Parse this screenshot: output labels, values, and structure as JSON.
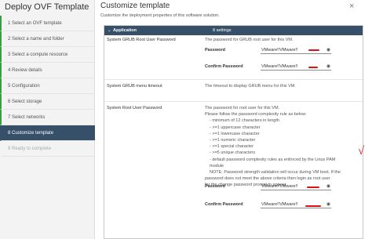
{
  "wizard": {
    "title": "Deploy OVF Template",
    "steps": [
      {
        "label": "1  Select an OVF template",
        "state": "done"
      },
      {
        "label": "2  Select a name and folder",
        "state": "done"
      },
      {
        "label": "3  Select a compute resource",
        "state": "done"
      },
      {
        "label": "4  Review details",
        "state": "done"
      },
      {
        "label": "5  Configuration",
        "state": "done"
      },
      {
        "label": "6  Select storage",
        "state": "done"
      },
      {
        "label": "7  Select networks",
        "state": "done"
      },
      {
        "label": "8  Customize template",
        "state": "active"
      },
      {
        "label": "9  Ready to complete",
        "state": "disabled"
      }
    ]
  },
  "main": {
    "title": "Customize template",
    "close_label": "×",
    "subtitle": "Customize the deployment properties of this software solution."
  },
  "props": {
    "header": {
      "chevron": "⌄",
      "group": "Application",
      "count": "8 settings"
    },
    "grub_password": {
      "name": "System GRUB Root User Password",
      "desc": "The password for GRUB root user for this VM.",
      "password_label": "Password",
      "password_value": "VMware!!VMware!!",
      "confirm_label": "Confirm Password",
      "confirm_value": "VMware!!VMware!!"
    },
    "grub_timeout": {
      "name": "System GRUB menu timeout",
      "desc": "The timeout to display GRUB menu for this VM."
    },
    "root_password": {
      "name": "System Root User Password",
      "desc_lines": [
        "The password for root user for this VM.",
        "Please follow the password complexity rule as below:",
        "- minimum of 12 characters in length",
        "- >=1 uppercase character",
        "- >=1 lowercase character",
        "- >=1 numeric character",
        "- >=1 special character",
        "- >=5 unique characters",
        "- default password complexity rules as enforced by the Linux PAM",
        "module",
        "NOTE: Password strength validation will occur during VM boot.  If the",
        "password does not meet the above criteria then login as root user",
        "for the change password prompt to appear."
      ],
      "password_label": "Password",
      "password_value": "VMware!!VMware!!",
      "confirm_label": "Confirm Password",
      "confirm_value": "VMware!!VMware!!"
    }
  },
  "icons": {
    "eye": "eye-icon",
    "close": "close-icon",
    "chevron": "chevron-down-icon"
  },
  "colors": {
    "accent": "#36506a",
    "done_step": "#3d9a49",
    "annotation": "#e01010"
  }
}
